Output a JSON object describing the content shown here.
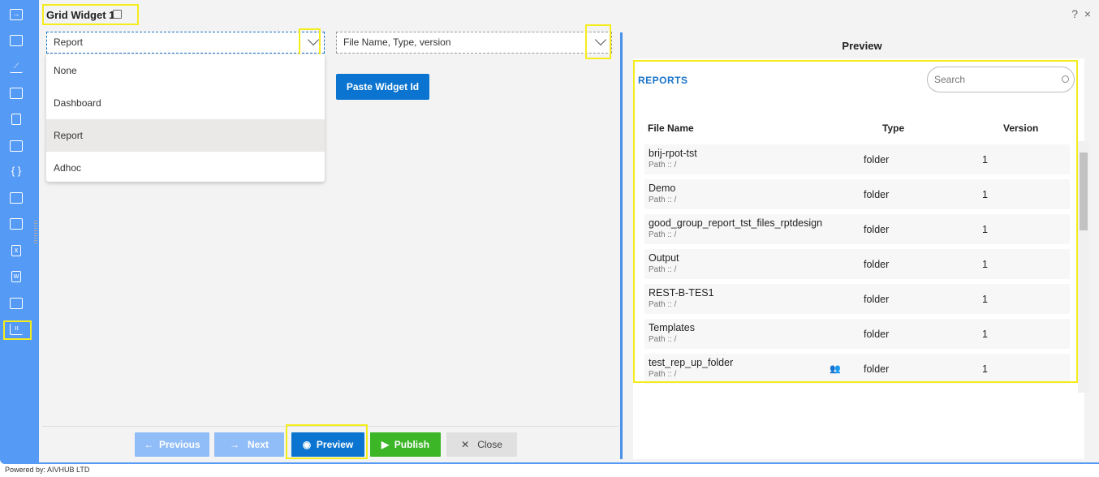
{
  "header": {
    "title": "Grid Widget 1",
    "help": "?",
    "close": "×"
  },
  "sidebar": {
    "icons": [
      "sign-in-icon",
      "table-icon",
      "chart-icon",
      "map-icon",
      "report-file-icon",
      "id-card-icon",
      "braces-icon",
      "image-chart-icon",
      "calendar-grid-icon",
      "excel-file-icon",
      "word-file-icon",
      "tree-icon",
      "grid-chart-icon"
    ],
    "active": "grid-chart-icon"
  },
  "left": {
    "type_select": {
      "value": "Report",
      "options": [
        "None",
        "Dashboard",
        "Report",
        "Adhoc"
      ]
    },
    "fields_select": {
      "value": "File Name, Type, version"
    },
    "paste_button": "Paste Widget Id"
  },
  "footer_buttons": {
    "previous": "Previous",
    "next": "Next",
    "preview": "Preview",
    "publish": "Publish",
    "close": "Close"
  },
  "preview": {
    "title": "Preview",
    "section": "REPORTS",
    "search_placeholder": "Search",
    "columns": [
      "File Name",
      "Type",
      "Version"
    ],
    "rows": [
      {
        "name": "brij-rpot-tst",
        "path": "Path :: /",
        "type": "folder",
        "version": "1"
      },
      {
        "name": "Demo",
        "path": "Path :: /",
        "type": "folder",
        "version": "1"
      },
      {
        "name": "good_group_report_tst_files_rptdesign",
        "path": "Path :: /",
        "type": "folder",
        "version": "1"
      },
      {
        "name": "Output",
        "path": "Path :: /",
        "type": "folder",
        "version": "1"
      },
      {
        "name": "REST-B-TES1",
        "path": "Path :: /",
        "type": "folder",
        "version": "1"
      },
      {
        "name": "Templates",
        "path": "Path :: /",
        "type": "folder",
        "version": "1"
      },
      {
        "name": "test_rep_up_folder",
        "path": "Path :: /",
        "type": "folder",
        "version": "1",
        "shared": true
      }
    ]
  },
  "powered_by": "Powered by: AIVHUB LTD",
  "colors": {
    "sidebar": "#559af5",
    "primary": "#0a74d0",
    "publish": "#3cb527",
    "disabled": "#90bdf7",
    "highlight": "#f5ec1c"
  }
}
